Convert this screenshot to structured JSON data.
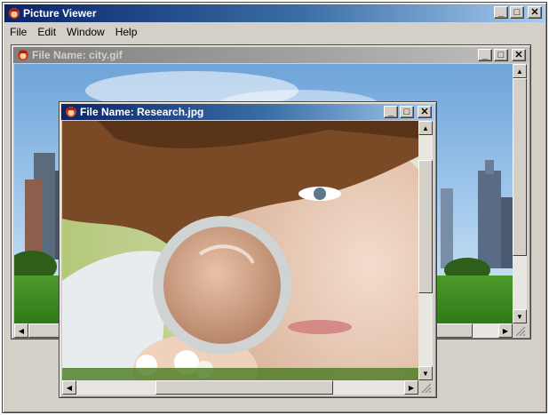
{
  "app": {
    "title": "Picture Viewer",
    "menu": [
      "File",
      "Edit",
      "Window",
      "Help"
    ]
  },
  "window_buttons": {
    "minimize": "_",
    "maximize": "□",
    "close": "✕"
  },
  "windows": [
    {
      "title": "File Name: city.gif",
      "state": "inactive"
    },
    {
      "title": "File Name: Research.jpg",
      "state": "active"
    }
  ],
  "colors": {
    "active_titlebar": "#0a246a",
    "inactive_titlebar": "#808080",
    "face": "#d4d0c8"
  }
}
